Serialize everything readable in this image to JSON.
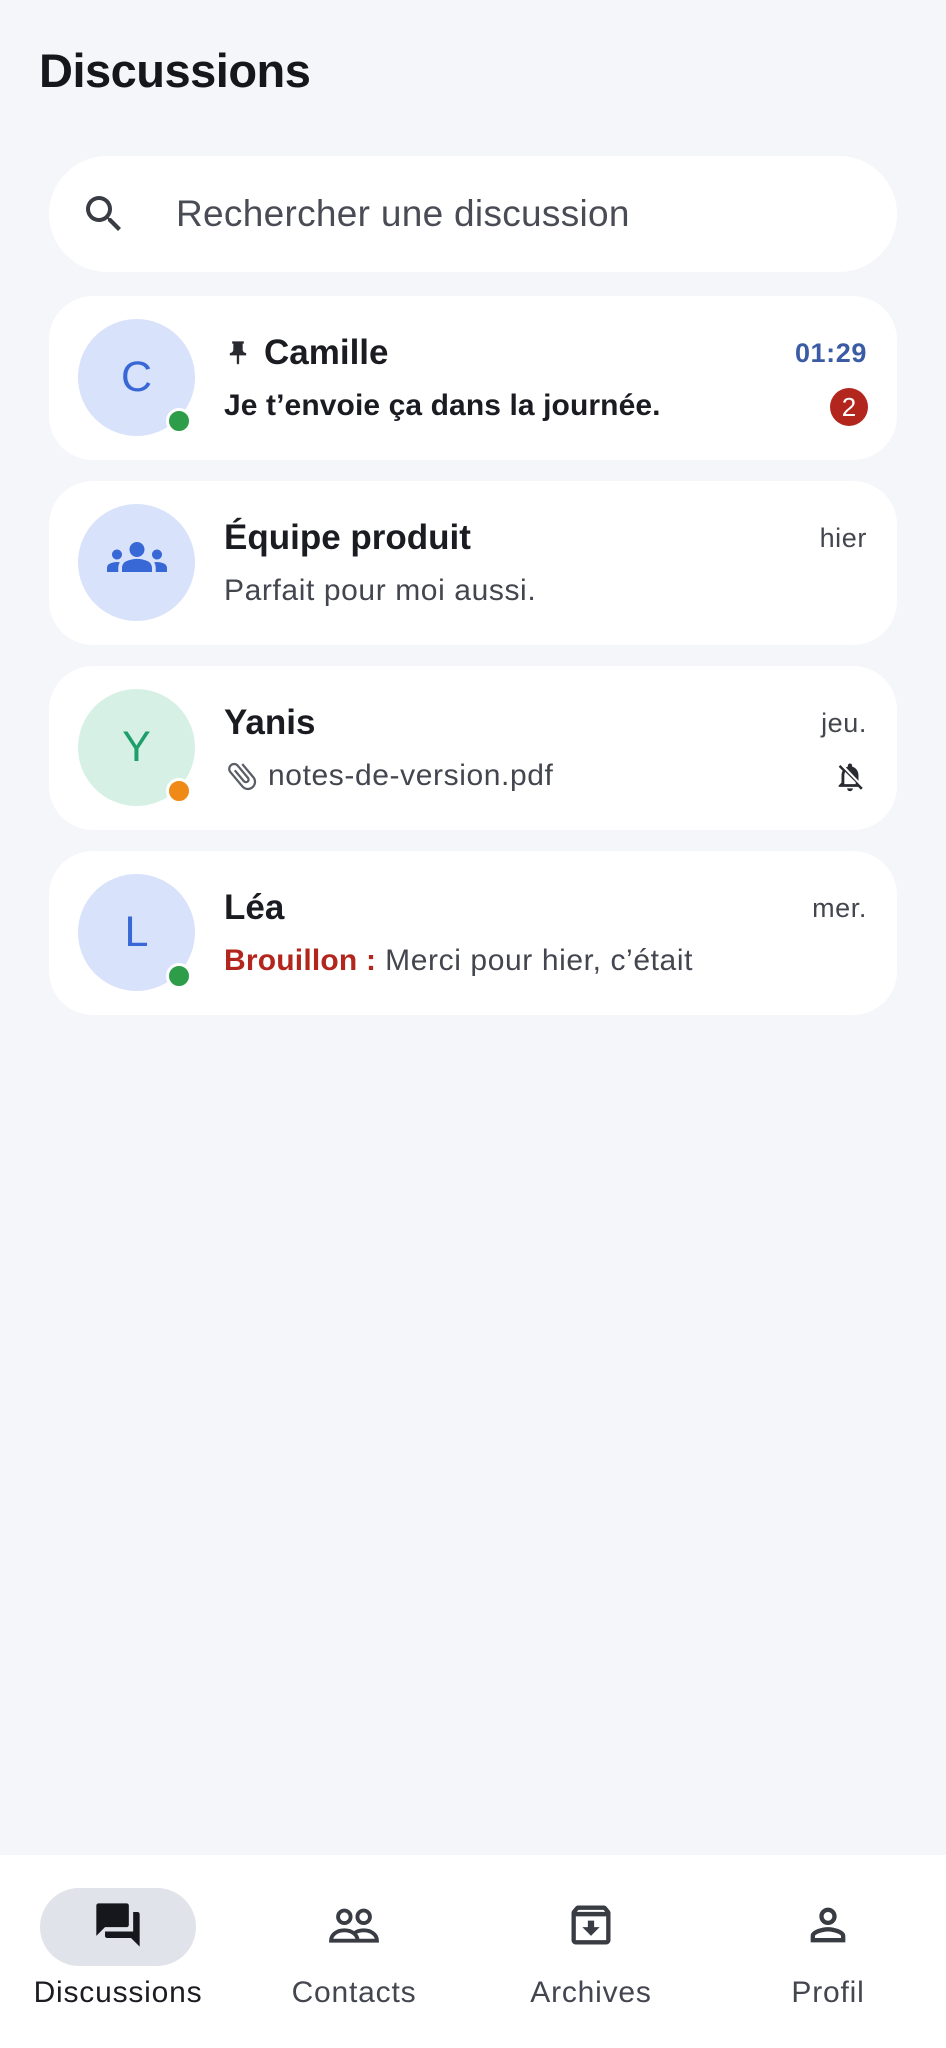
{
  "header": {
    "title": "Discussions"
  },
  "search": {
    "placeholder": "Rechercher une discussion",
    "icon": "search-icon"
  },
  "conversations": [
    {
      "name": "Camille",
      "initial": "C",
      "pinned": true,
      "time": "01:29",
      "preview": "Je t’envoie ça dans la journée.",
      "unread_count": "2",
      "presence": "online",
      "avatar_bg": "#d9e2fb",
      "avatar_fg": "#3867d6"
    },
    {
      "name": "Équipe produit",
      "initial": "",
      "avatar_icon": "group-icon",
      "time": "hier",
      "preview": "Parfait pour moi aussi.",
      "avatar_bg": "#d9e2fb",
      "avatar_fg": "#3867d6"
    },
    {
      "name": "Yanis",
      "initial": "Y",
      "time": "jeu.",
      "preview": "notes-de-version.pdf",
      "preview_icon": "paperclip-icon",
      "muted": true,
      "presence": "away",
      "avatar_bg": "#d6f0e6",
      "avatar_fg": "#1e9e6a"
    },
    {
      "name": "Léa",
      "initial": "L",
      "time": "mer.",
      "draft_label": "Brouillon :",
      "preview": "Merci pour hier, c’était",
      "presence": "online",
      "avatar_bg": "#d9e2fb",
      "avatar_fg": "#3867d6"
    }
  ],
  "nav": {
    "items": [
      {
        "label": "Discussions",
        "icon": "chat-icon",
        "active": true
      },
      {
        "label": "Contacts",
        "icon": "contacts-icon",
        "active": false
      },
      {
        "label": "Archives",
        "icon": "archive-icon",
        "active": false
      },
      {
        "label": "Profil",
        "icon": "profile-icon",
        "active": false
      }
    ]
  },
  "colors": {
    "background": "#f5f6fa",
    "surface": "#ffffff",
    "accent": "#3b5ba5",
    "badge": "#b3261e",
    "online": "#2e9d49",
    "away": "#f08a16"
  }
}
